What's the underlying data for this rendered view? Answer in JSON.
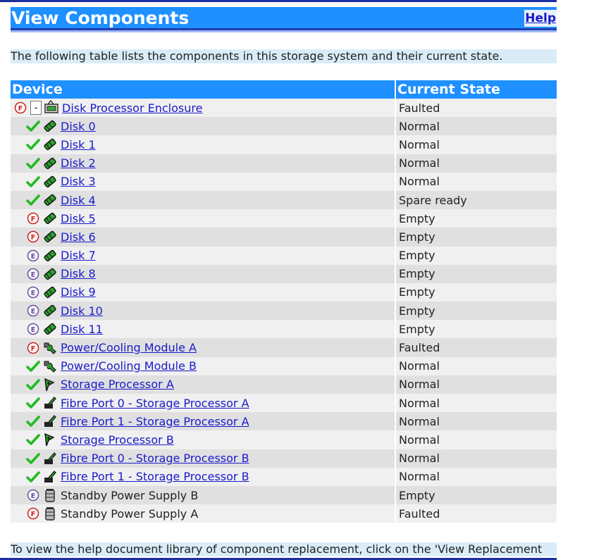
{
  "header": {
    "title": "View Components",
    "help_label": "Help"
  },
  "intro_text": "The following table lists the components in this storage system and their current state.",
  "table": {
    "columns": [
      "Device",
      "Current State"
    ],
    "rows": [
      {
        "indent": 0,
        "status": "faulted",
        "device_icon": "enclosure-icon",
        "label": "Disk Processor Enclosure",
        "state": "Faulted",
        "link": true,
        "toggle": "-"
      },
      {
        "indent": 1,
        "status": "ok",
        "device_icon": "disk-icon",
        "label": "Disk 0",
        "state": "Normal",
        "link": true
      },
      {
        "indent": 1,
        "status": "ok",
        "device_icon": "disk-icon",
        "label": "Disk 1",
        "state": "Normal",
        "link": true
      },
      {
        "indent": 1,
        "status": "ok",
        "device_icon": "disk-icon",
        "label": "Disk 2",
        "state": "Normal",
        "link": true
      },
      {
        "indent": 1,
        "status": "ok",
        "device_icon": "disk-icon",
        "label": "Disk 3",
        "state": "Normal",
        "link": true
      },
      {
        "indent": 1,
        "status": "ok",
        "device_icon": "disk-icon",
        "label": "Disk 4",
        "state": "Spare ready",
        "link": true
      },
      {
        "indent": 1,
        "status": "faulted",
        "device_icon": "disk-icon",
        "label": "Disk 5",
        "state": "Empty",
        "link": true
      },
      {
        "indent": 1,
        "status": "faulted",
        "device_icon": "disk-icon",
        "label": "Disk 6",
        "state": "Empty",
        "link": true
      },
      {
        "indent": 1,
        "status": "empty",
        "device_icon": "disk-icon",
        "label": "Disk 7",
        "state": "Empty",
        "link": true
      },
      {
        "indent": 1,
        "status": "empty",
        "device_icon": "disk-icon",
        "label": "Disk 8",
        "state": "Empty",
        "link": true
      },
      {
        "indent": 1,
        "status": "empty",
        "device_icon": "disk-icon",
        "label": "Disk 9",
        "state": "Empty",
        "link": true
      },
      {
        "indent": 1,
        "status": "empty",
        "device_icon": "disk-icon",
        "label": "Disk 10",
        "state": "Empty",
        "link": true
      },
      {
        "indent": 1,
        "status": "empty",
        "device_icon": "disk-icon",
        "label": "Disk 11",
        "state": "Empty",
        "link": true
      },
      {
        "indent": 1,
        "status": "faulted",
        "device_icon": "power-cooling-icon",
        "label": "Power/Cooling Module A",
        "state": "Faulted",
        "link": true
      },
      {
        "indent": 1,
        "status": "ok",
        "device_icon": "power-cooling-icon",
        "label": "Power/Cooling Module B",
        "state": "Normal",
        "link": true
      },
      {
        "indent": 1,
        "status": "ok",
        "device_icon": "storage-processor-icon",
        "label": "Storage Processor A",
        "state": "Normal",
        "link": true
      },
      {
        "indent": 1,
        "status": "ok",
        "device_icon": "fibre-port-icon",
        "label": "Fibre Port 0 - Storage Processor A",
        "state": "Normal",
        "link": true
      },
      {
        "indent": 1,
        "status": "ok",
        "device_icon": "fibre-port-icon",
        "label": "Fibre Port 1 - Storage Processor A",
        "state": "Normal",
        "link": true
      },
      {
        "indent": 1,
        "status": "ok",
        "device_icon": "storage-processor-icon",
        "label": "Storage Processor B",
        "state": "Normal",
        "link": true
      },
      {
        "indent": 1,
        "status": "ok",
        "device_icon": "fibre-port-icon",
        "label": "Fibre Port 0 - Storage Processor B",
        "state": "Normal",
        "link": true
      },
      {
        "indent": 1,
        "status": "ok",
        "device_icon": "fibre-port-icon",
        "label": "Fibre Port 1 - Storage Processor B",
        "state": "Normal",
        "link": true
      },
      {
        "indent": 1,
        "status": "empty",
        "device_icon": "battery-icon",
        "label": "Standby Power Supply B",
        "state": "Empty",
        "link": false
      },
      {
        "indent": 1,
        "status": "faulted",
        "device_icon": "battery-icon",
        "label": "Standby Power Supply A",
        "state": "Faulted",
        "link": false
      }
    ]
  },
  "footer_text": "To view the help document library of component replacement, click on the 'View Replacement",
  "colors": {
    "header_bg": "#1e90ff",
    "link": "#1a1acc",
    "ok_check": "#22bb22",
    "fault": "#cc2222",
    "empty": "#6a4fa0",
    "row_light": "#f0f0f0",
    "row_dark": "#e0e0e0"
  }
}
